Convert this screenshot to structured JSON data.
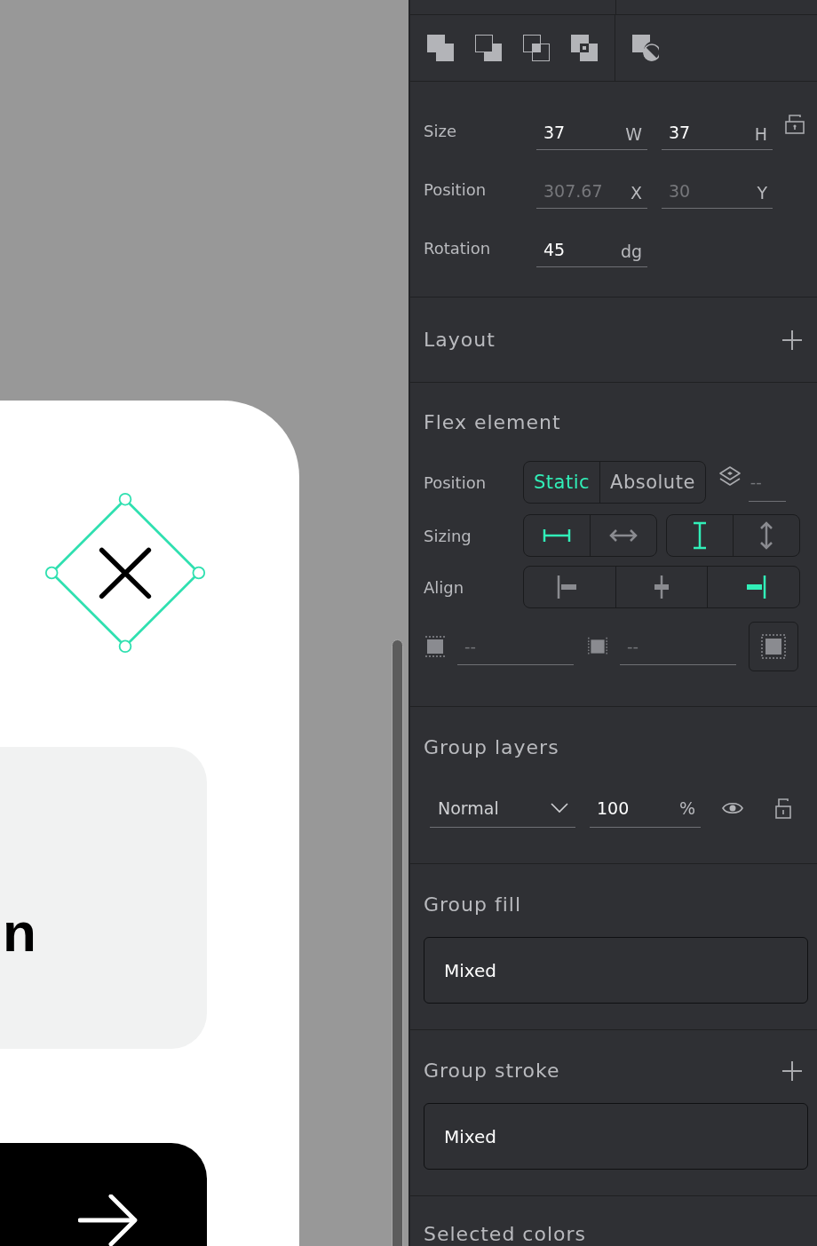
{
  "canvas": {
    "partial_text": "n"
  },
  "measures": [
    {
      "label": "Size",
      "lock": {
        "locked": false
      },
      "fields": [
        {
          "value": "37",
          "unit": "W",
          "disabled": false
        },
        {
          "value": "37",
          "unit": "H",
          "disabled": false
        }
      ]
    },
    {
      "label": "Position",
      "fields": [
        {
          "value": "307.67",
          "unit": "X",
          "disabled": true
        },
        {
          "value": "30",
          "unit": "Y",
          "disabled": true
        }
      ]
    },
    {
      "label": "Rotation",
      "fields": [
        {
          "value": "45",
          "unit": "dg",
          "disabled": false
        }
      ]
    }
  ],
  "layout": {
    "title": "Layout"
  },
  "flex_element": {
    "title": "Flex element",
    "position": {
      "label": "Position",
      "options": [
        {
          "label": "Static",
          "selected": true
        },
        {
          "label": "Absolute",
          "selected": false
        }
      ],
      "z_index": {
        "placeholder": "--"
      }
    },
    "sizing": {
      "label": "Sizing",
      "buttons": [
        {
          "kind": "fix-width",
          "selected": true
        },
        {
          "kind": "auto-width",
          "selected": false
        },
        {
          "kind": "fix-height",
          "selected": true
        },
        {
          "kind": "auto-height",
          "selected": false
        }
      ]
    },
    "align": {
      "label": "Align",
      "buttons": [
        {
          "kind": "start",
          "selected": false
        },
        {
          "kind": "center",
          "selected": false
        },
        {
          "kind": "end",
          "selected": true
        }
      ]
    },
    "padding": [
      {
        "kind": "vertical",
        "placeholder": "--"
      },
      {
        "kind": "horizontal",
        "placeholder": "--"
      }
    ]
  },
  "group_layers": {
    "title": "Group layers",
    "blend_mode": "Normal",
    "opacity": {
      "value": "100",
      "unit": "%"
    }
  },
  "group_fill": {
    "title": "Group fill",
    "value": "Mixed"
  },
  "group_stroke": {
    "title": "Group stroke",
    "value": "Mixed"
  },
  "selected_colors": {
    "title": "Selected colors"
  }
}
